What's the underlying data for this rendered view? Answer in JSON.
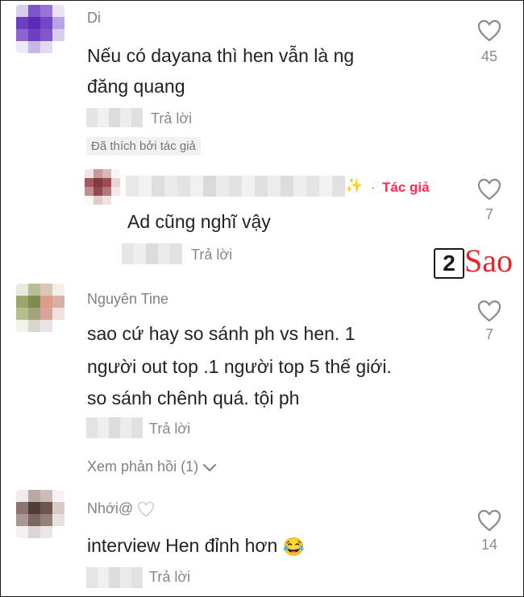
{
  "comments": [
    {
      "username": "Di",
      "text_lines": [
        "Nếu có dayana thì hen vẫn là ng",
        "đăng quang"
      ],
      "reply_label": "Trả lời",
      "liked_badge": "Đã thích bởi tác giả",
      "likes": "45"
    },
    {
      "author_tag": "Tác giả",
      "dot": "·",
      "text": "Ad cũng nghĩ vậy",
      "reply_label": "Trả lời",
      "likes": "7"
    },
    {
      "username": "Nguyên Tine",
      "text_lines": [
        "sao cứ hay so sánh ph vs hen. 1",
        "người out top .1 người top 5 thế giới.",
        "so sánh chênh quá. tội ph"
      ],
      "reply_label": "Trả lời",
      "view_replies": "Xem phản hồi (1)",
      "likes": "7"
    },
    {
      "username": "Nhới@",
      "text": "interview Hen đỉnh hơn",
      "emoji": "😂",
      "reply_label": "Trả lời",
      "likes": "14"
    }
  ],
  "watermark": {
    "number": "2",
    "word": "Sao"
  },
  "colors": {
    "author_tag": "#fe2c55",
    "muted": "#86878b",
    "text": "#222222",
    "watermark_red": "#e3262c"
  },
  "icons": [
    "heart-outline-icon",
    "chevron-down-icon",
    "sparkle-icon",
    "white-heart-icon",
    "laughing-emoji-icon"
  ]
}
